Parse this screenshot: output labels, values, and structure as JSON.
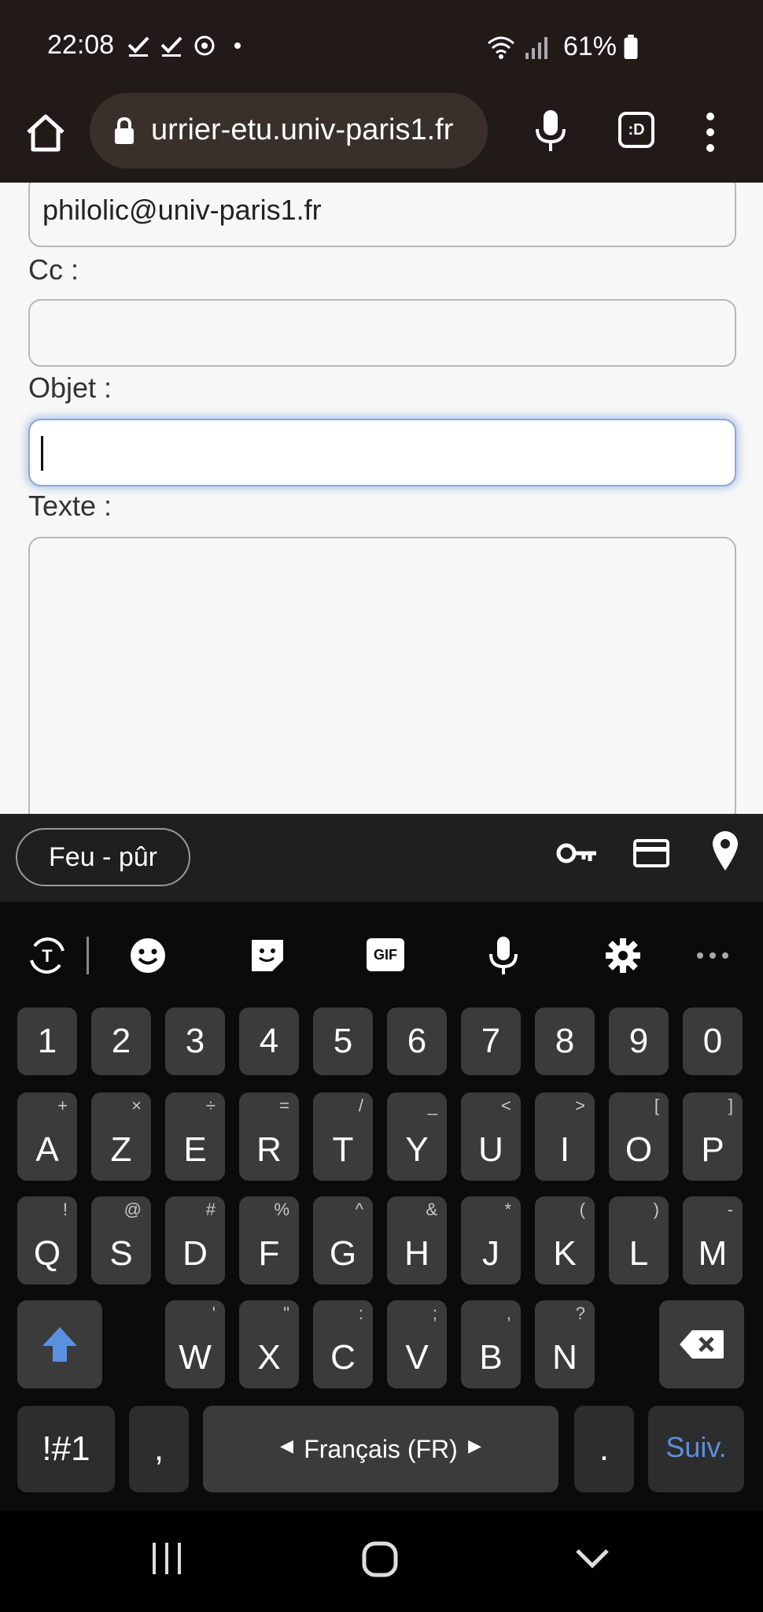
{
  "status_bar": {
    "time": "22:08",
    "battery": "61%"
  },
  "browser": {
    "url": "urrier-etu.univ-paris1.fr",
    "ext_label": ":D"
  },
  "form": {
    "to_value": "philolic@univ-paris1.fr",
    "cc_label": "Cc :",
    "subject_label": "Objet :",
    "text_label": "Texte :"
  },
  "autofill": {
    "chip": "Feu - pûr"
  },
  "keyboard": {
    "toolbar": {
      "gif": "GIF"
    },
    "number_row": [
      "1",
      "2",
      "3",
      "4",
      "5",
      "6",
      "7",
      "8",
      "9",
      "0"
    ],
    "row1": [
      {
        "k": "A",
        "s": "+"
      },
      {
        "k": "Z",
        "s": "×"
      },
      {
        "k": "E",
        "s": "÷"
      },
      {
        "k": "R",
        "s": "="
      },
      {
        "k": "T",
        "s": "/"
      },
      {
        "k": "Y",
        "s": "_"
      },
      {
        "k": "U",
        "s": "<"
      },
      {
        "k": "I",
        "s": ">"
      },
      {
        "k": "O",
        "s": "["
      },
      {
        "k": "P",
        "s": "]"
      }
    ],
    "row2": [
      {
        "k": "Q",
        "s": "!"
      },
      {
        "k": "S",
        "s": "@"
      },
      {
        "k": "D",
        "s": "#"
      },
      {
        "k": "F",
        "s": "%"
      },
      {
        "k": "G",
        "s": "^"
      },
      {
        "k": "H",
        "s": "&"
      },
      {
        "k": "J",
        "s": "*"
      },
      {
        "k": "K",
        "s": "("
      },
      {
        "k": "L",
        "s": ")"
      },
      {
        "k": "M",
        "s": "-"
      }
    ],
    "row3": [
      {
        "k": "W",
        "s": "'"
      },
      {
        "k": "X",
        "s": "\""
      },
      {
        "k": "C",
        "s": ":"
      },
      {
        "k": "V",
        "s": ";"
      },
      {
        "k": "B",
        "s": ","
      },
      {
        "k": "N",
        "s": "?"
      }
    ],
    "symbols_key": "!#1",
    "comma_key": ",",
    "space_label": "Français (FR)",
    "period_key": ".",
    "action_key": "Suiv.",
    "action_color": "#5b8fe0"
  }
}
